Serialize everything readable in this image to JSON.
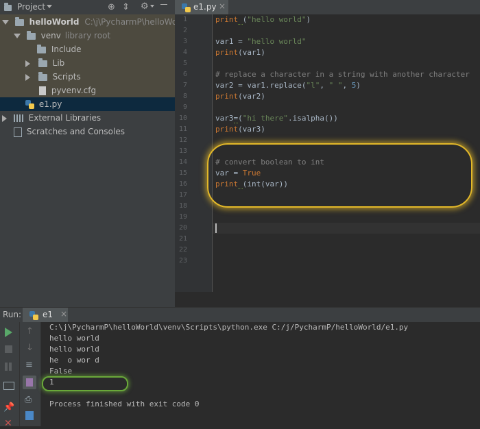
{
  "project_panel": {
    "header_label": "Project",
    "tree": [
      {
        "label": "helloWorld",
        "path": "C:\\j\\PycharmP\\helloWorld"
      },
      {
        "label": "venv",
        "hint": "library root"
      },
      {
        "label": "Include"
      },
      {
        "label": "Lib"
      },
      {
        "label": "Scripts"
      },
      {
        "label": "pyvenv.cfg"
      },
      {
        "label": "e1.py"
      },
      {
        "label": "External Libraries"
      },
      {
        "label": "Scratches and Consoles"
      }
    ]
  },
  "editor": {
    "tab_label": "e1.py",
    "line_numbers": [
      "1",
      "2",
      "3",
      "4",
      "5",
      "6",
      "7",
      "8",
      "9",
      "10",
      "11",
      "12",
      "13",
      "14",
      "15",
      "16",
      "17",
      "18",
      "19",
      "20",
      "21",
      "22",
      "23"
    ]
  },
  "run_panel": {
    "label": "Run:",
    "config_name": "e1",
    "output": [
      "C:\\j\\PycharmP\\helloWorld\\venv\\Scripts\\python.exe C:/j/PycharmP/helloWorld/e1.py",
      "hello world",
      "hello world",
      "he  o wor d",
      "False",
      "1",
      "",
      "Process finished with exit code 0"
    ]
  },
  "colors": {
    "highlight_yellow": "#e3b829",
    "highlight_green": "#6aa93a",
    "selection_blue": "#0d293e"
  }
}
